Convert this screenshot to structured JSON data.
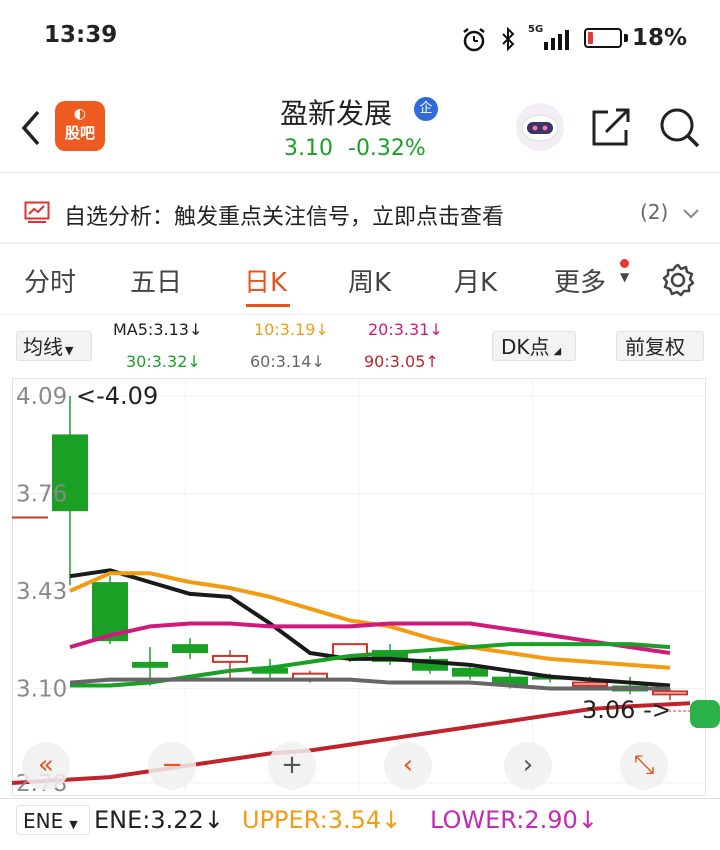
{
  "status": {
    "time": "13:39",
    "battery": "18%",
    "battery_level": 0.18,
    "network": "5G"
  },
  "header": {
    "app_logo_text": "股吧",
    "stock_name": "盈新发展",
    "badge": "企",
    "price": "3.10",
    "change": "-0.32%"
  },
  "signal_bar": {
    "text": "自选分析：触发重点关注信号，立即点击查看",
    "count": "(2)"
  },
  "tabs": [
    "分时",
    "五日",
    "日K",
    "周K",
    "月K",
    "更多"
  ],
  "active_tab": "日K",
  "ma": {
    "selector": "均线",
    "ma5": "MA5:3.13↓",
    "ma10": "10:3.19↓",
    "ma20": "20:3.31↓",
    "ma30": "30:3.32↓",
    "ma60": "60:3.14↓",
    "ma90": "90:3.05↑",
    "dk_button": "DK点",
    "fuquan_button": "前复权"
  },
  "chart_data": {
    "type": "candlestick",
    "y_ticks": [
      "4.09",
      "3.76",
      "3.43",
      "3.10",
      "2.78"
    ],
    "max_label": "<-4.09",
    "min_label": "3.06 ->",
    "ylim": [
      2.78,
      4.09
    ],
    "candles": [
      {
        "o": 3.7,
        "h": 4.09,
        "l": 3.45,
        "c": 3.96,
        "color": "green"
      },
      {
        "o": 3.46,
        "h": 3.48,
        "l": 3.25,
        "c": 3.26,
        "color": "green"
      },
      {
        "o": 3.19,
        "h": 3.24,
        "l": 3.11,
        "c": 3.17,
        "color": "green"
      },
      {
        "o": 3.25,
        "h": 3.27,
        "l": 3.2,
        "c": 3.22,
        "color": "green"
      },
      {
        "o": 3.21,
        "h": 3.23,
        "l": 3.13,
        "c": 3.19,
        "color": "red"
      },
      {
        "o": 3.17,
        "h": 3.2,
        "l": 3.13,
        "c": 3.15,
        "color": "green"
      },
      {
        "o": 3.13,
        "h": 3.16,
        "l": 3.12,
        "c": 3.15,
        "color": "red"
      },
      {
        "o": 3.2,
        "h": 3.25,
        "l": 3.19,
        "c": 3.25,
        "color": "red"
      },
      {
        "o": 3.23,
        "h": 3.25,
        "l": 3.18,
        "c": 3.19,
        "color": "green"
      },
      {
        "o": 3.2,
        "h": 3.21,
        "l": 3.15,
        "c": 3.16,
        "color": "green"
      },
      {
        "o": 3.17,
        "h": 3.18,
        "l": 3.13,
        "c": 3.14,
        "color": "green"
      },
      {
        "o": 3.14,
        "h": 3.16,
        "l": 3.1,
        "c": 3.11,
        "color": "green"
      },
      {
        "o": 3.14,
        "h": 3.15,
        "l": 3.12,
        "c": 3.13,
        "color": "green"
      },
      {
        "o": 3.12,
        "h": 3.14,
        "l": 3.1,
        "c": 3.11,
        "color": "red"
      },
      {
        "o": 3.11,
        "h": 3.14,
        "l": 3.08,
        "c": 3.09,
        "color": "green"
      },
      {
        "o": 3.09,
        "h": 3.1,
        "l": 3.06,
        "c": 3.08,
        "color": "red"
      }
    ],
    "lines": [
      {
        "name": "MA5",
        "color": "#1a1a1a",
        "values": [
          3.48,
          3.5,
          3.46,
          3.42,
          3.41,
          3.32,
          3.22,
          3.2,
          3.2,
          3.19,
          3.18,
          3.16,
          3.14,
          3.13,
          3.12,
          3.11
        ]
      },
      {
        "name": "MA10",
        "color": "#f39c12",
        "values": [
          3.43,
          3.49,
          3.49,
          3.46,
          3.44,
          3.41,
          3.37,
          3.33,
          3.31,
          3.27,
          3.24,
          3.22,
          3.2,
          3.19,
          3.18,
          3.17
        ]
      },
      {
        "name": "MA20",
        "color": "#d0197d",
        "values": [
          3.24,
          3.28,
          3.31,
          3.32,
          3.32,
          3.31,
          3.31,
          3.31,
          3.32,
          3.32,
          3.32,
          3.3,
          3.28,
          3.26,
          3.24,
          3.22
        ]
      },
      {
        "name": "MA30",
        "color": "#1aa025",
        "values": [
          3.11,
          3.11,
          3.12,
          3.14,
          3.16,
          3.17,
          3.19,
          3.21,
          3.22,
          3.23,
          3.24,
          3.25,
          3.25,
          3.25,
          3.25,
          3.24
        ]
      },
      {
        "name": "MA60",
        "color": "#666666",
        "values": [
          3.12,
          3.13,
          3.13,
          3.13,
          3.13,
          3.13,
          3.13,
          3.13,
          3.12,
          3.12,
          3.12,
          3.11,
          3.1,
          3.1,
          3.1,
          3.1
        ]
      },
      {
        "name": "MA90",
        "color": "#c0232c",
        "values": [
          2.78,
          2.8,
          2.82,
          2.84,
          2.86,
          2.88,
          2.89,
          2.91,
          2.93,
          2.95,
          2.97,
          2.99,
          3.01,
          3.03,
          3.04,
          3.05
        ]
      }
    ]
  },
  "chart_controls": [
    "«",
    "−",
    "+",
    "‹",
    "›",
    "⤡"
  ],
  "ene": {
    "selector": "ENE",
    "ene": "ENE:3.22↓",
    "upper": "UPPER:3.54↓",
    "lower": "LOWER:2.90↓"
  }
}
